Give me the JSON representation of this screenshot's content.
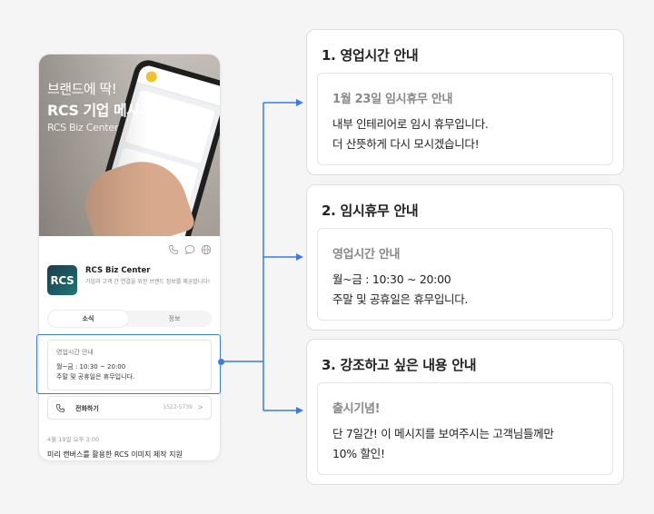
{
  "phone": {
    "hero": {
      "line1": "브랜드에 딱!",
      "line2": "RCS 기업 메시지",
      "line3": "RCS Biz Center"
    },
    "brand": {
      "logo_text": "RCS",
      "name": "RCS Biz Center",
      "description": "기업과 고객 간 연결을 위한 브랜드 정보를 제공합니다!"
    },
    "tabs": [
      "소식",
      "정보"
    ],
    "message": {
      "title": "영업시간 안내",
      "lines": [
        "월~금 : 10:30 ~ 20:00",
        "주말 및 공휴일은 휴무입니다."
      ]
    },
    "call": {
      "label": "전화하기",
      "number": "1522-5739",
      "chevron": ">"
    },
    "post": {
      "date": "4월 19일 오후 3:00",
      "title": "미리 캔버스를 활용한 RCS 이미지 제작 지원"
    }
  },
  "cards": [
    {
      "title": "1. 영업시간 안내",
      "heading": "1월 23일 임시휴무 안내",
      "lines": [
        "내부 인테리어로 임시 휴무입니다.",
        "더 산뜻하게 다시 모시겠습니다!"
      ]
    },
    {
      "title": "2. 임시휴무 안내",
      "heading": "영업시간 안내",
      "lines": [
        "월~금 : 10:30 ~ 20:00",
        "주말 및 공휴일은 휴무입니다."
      ]
    },
    {
      "title": "3. 강조하고 싶은 내용 안내",
      "heading": "출시기념!",
      "lines": [
        "단 7일간! 이 메시지를 보여주시는 고객님들께만",
        "10% 할인!"
      ]
    }
  ],
  "colors": {
    "accent": "#3c7be6",
    "background": "#f5f5f5"
  }
}
